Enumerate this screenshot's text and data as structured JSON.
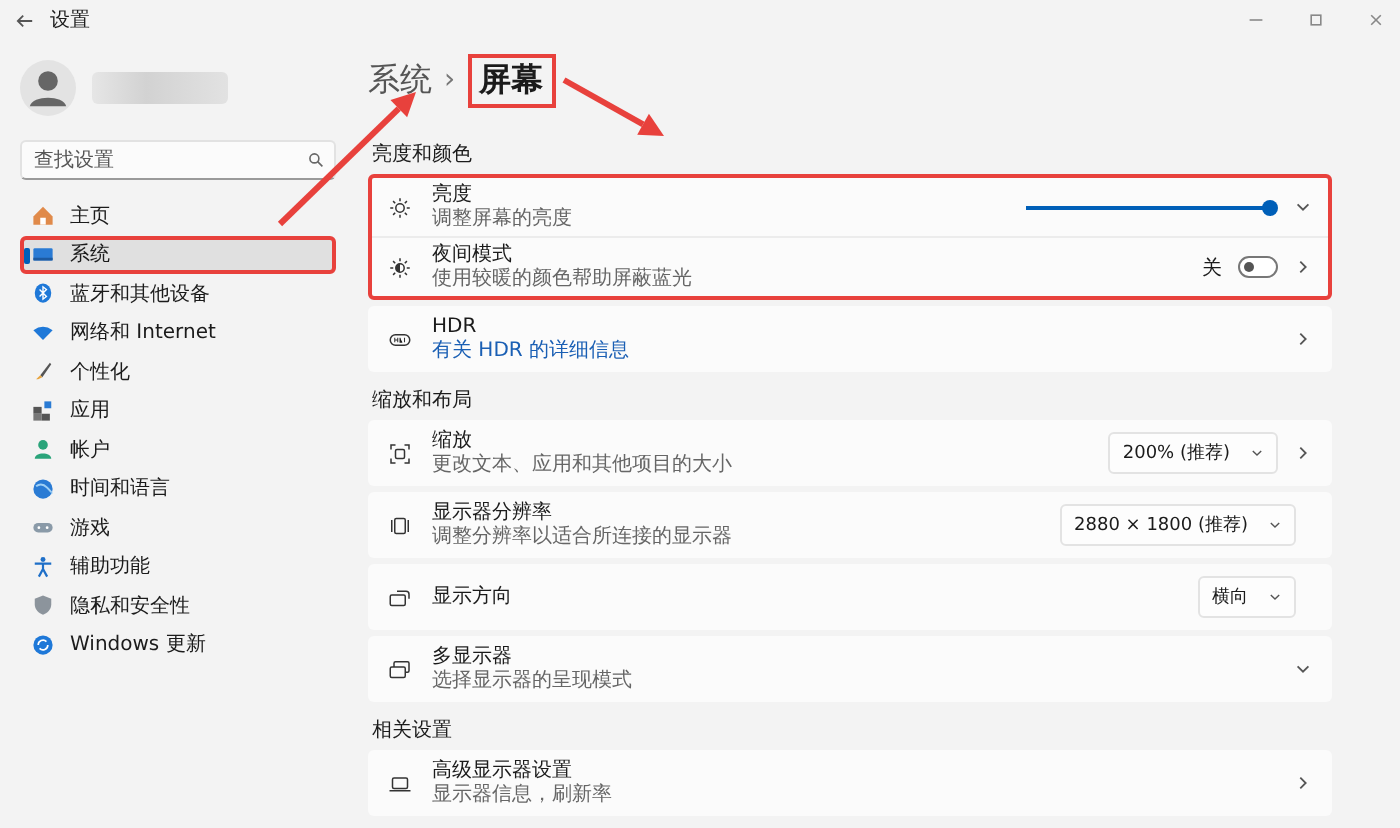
{
  "window": {
    "title": "设置"
  },
  "sidebar": {
    "search": {
      "placeholder": "查找设置"
    },
    "items": [
      {
        "label": "主页",
        "selected": false,
        "highlighted": false
      },
      {
        "label": "系统",
        "selected": true,
        "highlighted": true
      },
      {
        "label": "蓝牙和其他设备",
        "selected": false,
        "highlighted": false
      },
      {
        "label": "网络和 Internet",
        "selected": false,
        "highlighted": false
      },
      {
        "label": "个性化",
        "selected": false,
        "highlighted": false
      },
      {
        "label": "应用",
        "selected": false,
        "highlighted": false
      },
      {
        "label": "帐户",
        "selected": false,
        "highlighted": false
      },
      {
        "label": "时间和语言",
        "selected": false,
        "highlighted": false
      },
      {
        "label": "游戏",
        "selected": false,
        "highlighted": false
      },
      {
        "label": "辅助功能",
        "selected": false,
        "highlighted": false
      },
      {
        "label": "隐私和安全性",
        "selected": false,
        "highlighted": false
      },
      {
        "label": "Windows 更新",
        "selected": false,
        "highlighted": false
      }
    ]
  },
  "breadcrumb": {
    "parent": "系统",
    "separator": "›",
    "current": "屏幕",
    "highlighted": true
  },
  "sections": [
    {
      "header": "亮度和颜色",
      "groups": [
        {
          "highlighted": true,
          "rows": [
            {
              "kind": "slider",
              "title": "亮度",
              "subtitle": "调整屏幕的亮度",
              "level": 1.0
            },
            {
              "kind": "toggle",
              "title": "夜间模式",
              "subtitle": "使用较暖的颜色帮助屏蔽蓝光",
              "on": false,
              "state_label": "关"
            }
          ]
        },
        {
          "highlighted": false,
          "rows": [
            {
              "kind": "link",
              "title": "HDR",
              "subtitle": "有关 HDR 的详细信息"
            }
          ]
        }
      ]
    },
    {
      "header": "缩放和布局",
      "groups": [
        {
          "highlighted": false,
          "rows": [
            {
              "kind": "dropdown",
              "title": "缩放",
              "subtitle": "更改文本、应用和其他项目的大小",
              "value": "200% (推荐)"
            }
          ]
        },
        {
          "highlighted": false,
          "rows": [
            {
              "kind": "dropdown",
              "title": "显示器分辨率",
              "subtitle": "调整分辨率以适合所连接的显示器",
              "value": "2880 × 1800 (推荐)"
            }
          ]
        },
        {
          "highlighted": false,
          "rows": [
            {
              "kind": "dropdown",
              "title": "显示方向",
              "value": "横向"
            }
          ]
        },
        {
          "highlighted": false,
          "rows": [
            {
              "kind": "plain",
              "title": "多显示器",
              "subtitle": "选择显示器的呈现模式"
            }
          ]
        }
      ]
    },
    {
      "header": "相关设置",
      "groups": [
        {
          "highlighted": false,
          "rows": [
            {
              "kind": "plain",
              "title": "高级显示器设置",
              "subtitle": "显示器信息，刷新率"
            }
          ]
        }
      ]
    }
  ],
  "annotations": [
    {
      "kind": "arrow"
    },
    {
      "kind": "arrow"
    }
  ]
}
